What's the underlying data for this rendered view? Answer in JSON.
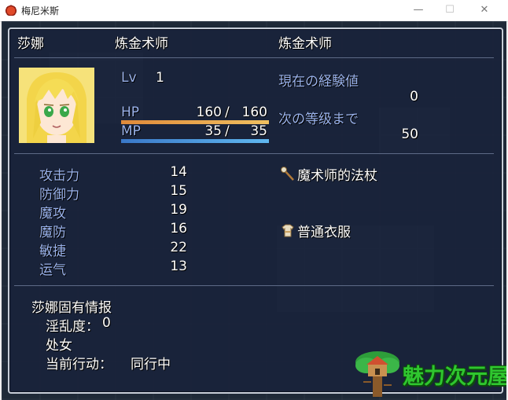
{
  "window": {
    "title": "梅尼米斯",
    "minimize": "—",
    "maximize": "☐",
    "close": "✕"
  },
  "actor": {
    "name": "莎娜",
    "class": "炼金术师",
    "nickname": "炼金术师",
    "level_label": "Lv",
    "level": "1",
    "hp_label": "HP",
    "hp": "160",
    "mhp": "160",
    "mp_label": "MP",
    "mp": "35",
    "mmp": "35",
    "hp_ratio": 1.0,
    "mp_ratio": 1.0,
    "separator": "/"
  },
  "exp": {
    "current_label": "現在の経験値",
    "current_value": "0",
    "next_label": "次の等级まで",
    "next_value": "50"
  },
  "params": [
    {
      "label": "攻击力",
      "value": "14"
    },
    {
      "label": "防御力",
      "value": "15"
    },
    {
      "label": "魔攻",
      "value": "19"
    },
    {
      "label": "魔防",
      "value": "16"
    },
    {
      "label": "敏捷",
      "value": "22"
    },
    {
      "label": "运气",
      "value": "13"
    }
  ],
  "equips": [
    {
      "icon": "staff-icon",
      "name": "魔术师的法杖"
    },
    {
      "icon": "clothes-icon",
      "name": "普通衣服"
    }
  ],
  "profile": {
    "title": "莎娜固有情报",
    "lewdness_label": "淫乱度：",
    "lewdness_value": "0",
    "status": "处女",
    "action_label": "当前行动：",
    "action_value": "同行中"
  },
  "watermark": {
    "text": "魅力次元屋"
  },
  "colors": {
    "hp_gauge_start": "#e08a3a",
    "hp_gauge_end": "#f0c060",
    "mp_gauge_start": "#3a78c8",
    "mp_gauge_end": "#60b8f0",
    "system_text": "#9ab3ee",
    "watermark_text": "#2fc62f"
  }
}
